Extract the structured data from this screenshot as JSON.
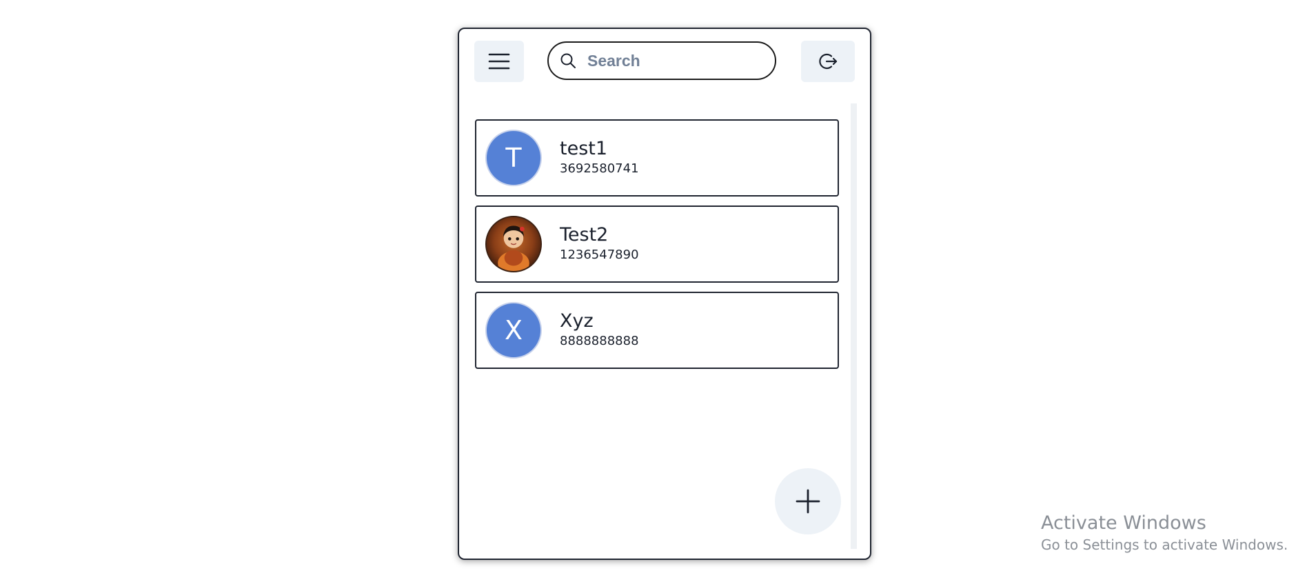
{
  "header": {
    "menu_icon": "hamburger-menu-icon",
    "search": {
      "icon": "search-icon",
      "placeholder": "Search",
      "value": ""
    },
    "logout_icon": "logout-icon"
  },
  "contacts": [
    {
      "initial": "T",
      "name": "test1",
      "phone": "3692580741",
      "avatar_type": "initial"
    },
    {
      "initial": "",
      "name": "Test2",
      "phone": "1236547890",
      "avatar_type": "photo"
    },
    {
      "initial": "X",
      "name": "Xyz",
      "phone": "8888888888",
      "avatar_type": "initial"
    }
  ],
  "fab": {
    "icon": "plus-icon"
  },
  "colors": {
    "avatar_bg": "#5581d6",
    "button_bg": "#edf2f7",
    "border": "#1f2430",
    "text": "#1a202c"
  },
  "watermark": {
    "title": "Activate Windows",
    "subtitle": "Go to Settings to activate Windows."
  }
}
